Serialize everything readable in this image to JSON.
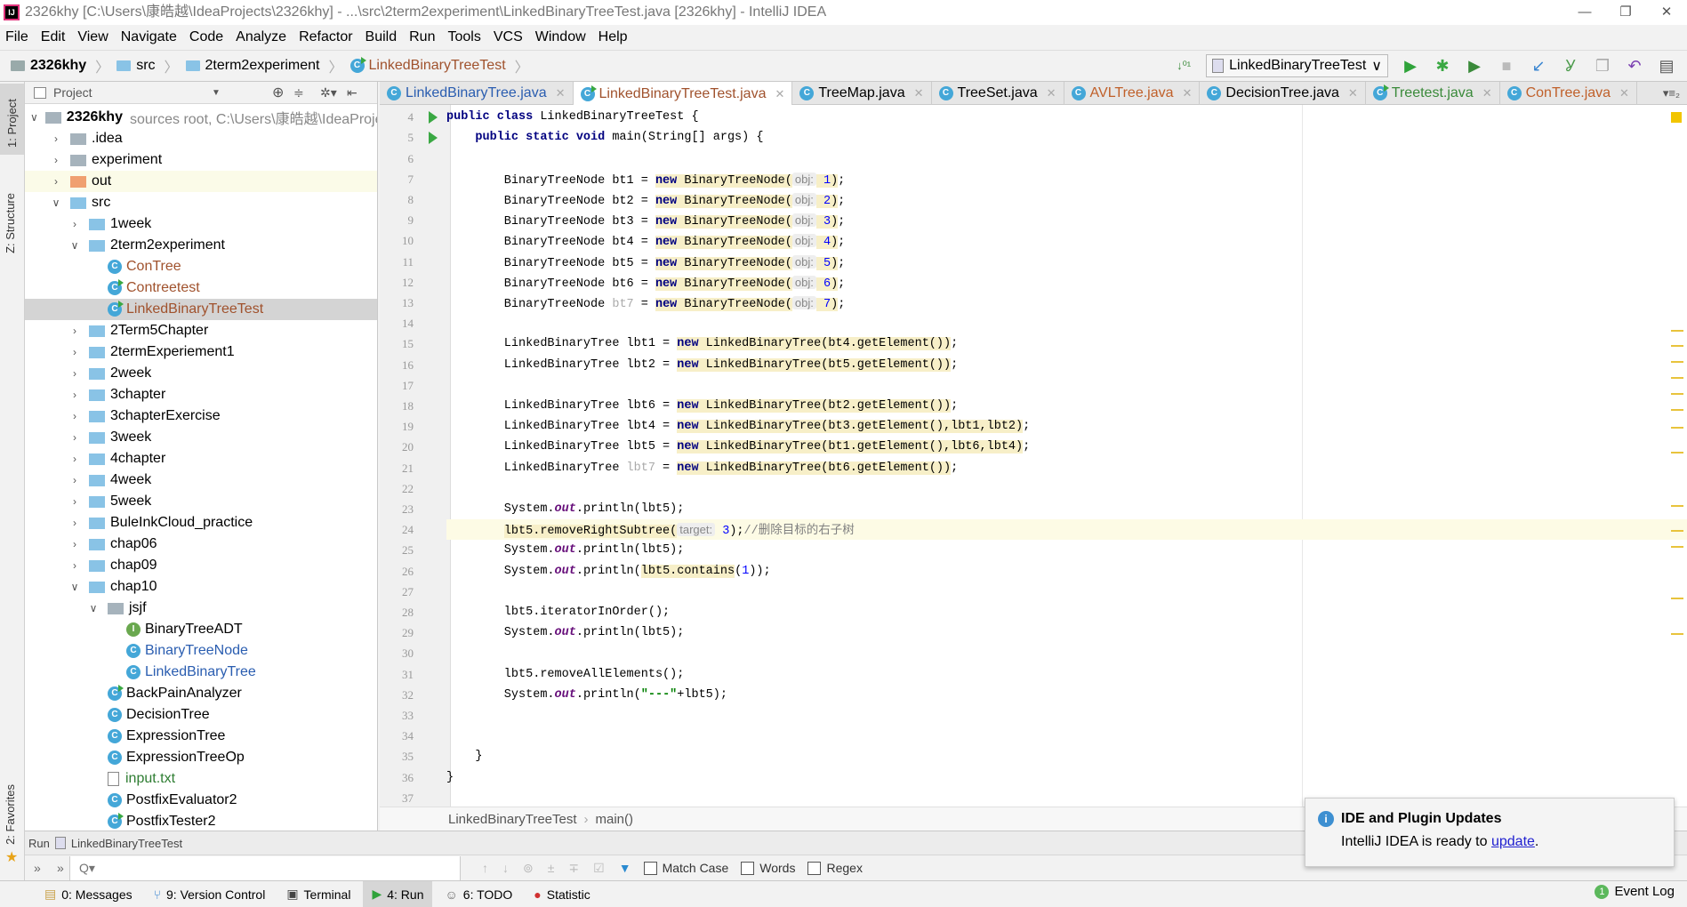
{
  "title_bar": {
    "text": "2326khy [C:\\Users\\康皓越\\IdeaProjects\\2326khy] - ...\\src\\2term2experiment\\LinkedBinaryTreeTest.java [2326khy] - IntelliJ IDEA",
    "minimize": "—",
    "maximize": "❐",
    "close": "✕"
  },
  "menu": [
    "File",
    "Edit",
    "View",
    "Navigate",
    "Code",
    "Analyze",
    "Refactor",
    "Build",
    "Run",
    "Tools",
    "VCS",
    "Window",
    "Help"
  ],
  "nav": {
    "project": "2326khy",
    "src": "src",
    "package": "2term2experiment",
    "file": "LinkedBinaryTreeTest"
  },
  "toolbar": {
    "run_config": "LinkedBinaryTreeTest",
    "icons": [
      "sort-icon",
      "run-icon",
      "debug-icon",
      "coverage-icon",
      "stop-icon",
      "vcs-update-icon",
      "vcs-commit-icon",
      "vcs-compare-icon",
      "revert-icon",
      "structure-icon"
    ]
  },
  "left_stripe": {
    "project": "1: Project",
    "structure": "Z: Structure",
    "favorites": "2: Favorites"
  },
  "project_panel": {
    "title": "Project",
    "tree": [
      {
        "label": "2326khy",
        "suffix": "sources root,  C:\\Users\\康皓越\\IdeaProjects",
        "depth": 0,
        "kind": "module",
        "open": true
      },
      {
        "label": ".idea",
        "depth": 1,
        "kind": "folder-gray",
        "open": false
      },
      {
        "label": "experiment",
        "depth": 1,
        "kind": "folder-gray",
        "open": false
      },
      {
        "label": "out",
        "depth": 1,
        "kind": "folder-orange",
        "open": false,
        "hl": true
      },
      {
        "label": "src",
        "depth": 1,
        "kind": "folder",
        "open": true
      },
      {
        "label": "1week",
        "depth": 2,
        "kind": "folder",
        "open": false
      },
      {
        "label": "2term2experiment",
        "depth": 2,
        "kind": "folder",
        "open": true
      },
      {
        "label": "ConTree",
        "depth": 3,
        "kind": "class",
        "color": "#a0522d"
      },
      {
        "label": "Contreetest",
        "depth": 3,
        "kind": "class-run",
        "color": "#a0522d"
      },
      {
        "label": "LinkedBinaryTreeTest",
        "depth": 3,
        "kind": "class-run",
        "color": "#a0522d",
        "selected": true
      },
      {
        "label": "2Term5Chapter",
        "depth": 2,
        "kind": "folder",
        "open": false
      },
      {
        "label": "2termExperiement1",
        "depth": 2,
        "kind": "folder",
        "open": false
      },
      {
        "label": "2week",
        "depth": 2,
        "kind": "folder",
        "open": false
      },
      {
        "label": "3chapter",
        "depth": 2,
        "kind": "folder",
        "open": false
      },
      {
        "label": "3chapterExercise",
        "depth": 2,
        "kind": "folder",
        "open": false
      },
      {
        "label": "3week",
        "depth": 2,
        "kind": "folder",
        "open": false
      },
      {
        "label": "4chapter",
        "depth": 2,
        "kind": "folder",
        "open": false
      },
      {
        "label": "4week",
        "depth": 2,
        "kind": "folder",
        "open": false
      },
      {
        "label": "5week",
        "depth": 2,
        "kind": "folder",
        "open": false
      },
      {
        "label": "BuleInkCloud_practice",
        "depth": 2,
        "kind": "folder",
        "open": false
      },
      {
        "label": "chap06",
        "depth": 2,
        "kind": "folder",
        "open": false
      },
      {
        "label": "chap09",
        "depth": 2,
        "kind": "folder",
        "open": false
      },
      {
        "label": "chap10",
        "depth": 2,
        "kind": "folder",
        "open": true
      },
      {
        "label": "jsjf",
        "depth": 3,
        "kind": "folder-gray",
        "open": true
      },
      {
        "label": "BinaryTreeADT",
        "depth": 4,
        "kind": "interface"
      },
      {
        "label": "BinaryTreeNode",
        "depth": 4,
        "kind": "class",
        "color": "#2a5db0"
      },
      {
        "label": "LinkedBinaryTree",
        "depth": 4,
        "kind": "class",
        "color": "#2a5db0"
      },
      {
        "label": "BackPainAnalyzer",
        "depth": 3,
        "kind": "class-run"
      },
      {
        "label": "DecisionTree",
        "depth": 3,
        "kind": "class"
      },
      {
        "label": "ExpressionTree",
        "depth": 3,
        "kind": "class"
      },
      {
        "label": "ExpressionTreeOp",
        "depth": 3,
        "kind": "class"
      },
      {
        "label": "input.txt",
        "depth": 3,
        "kind": "text",
        "color": "#2e7d32"
      },
      {
        "label": "PostfixEvaluator2",
        "depth": 3,
        "kind": "class"
      },
      {
        "label": "PostfixTester2",
        "depth": 3,
        "kind": "class-run"
      }
    ]
  },
  "tabs": [
    {
      "label": "LinkedBinaryTree.java",
      "color": "#2a5db0",
      "kind": "class"
    },
    {
      "label": "LinkedBinaryTreeTest.java",
      "color": "#a0522d",
      "kind": "class-run",
      "active": true
    },
    {
      "label": "TreeMap.java",
      "color": "#000000",
      "kind": "class"
    },
    {
      "label": "TreeSet.java",
      "color": "#000000",
      "kind": "class"
    },
    {
      "label": "AVLTree.java",
      "color": "#c0602a",
      "kind": "class"
    },
    {
      "label": "DecisionTree.java",
      "color": "#000000",
      "kind": "class"
    },
    {
      "label": "Treetest.java",
      "color": "#3a8a3a",
      "kind": "class-run"
    },
    {
      "label": "ConTree.java",
      "color": "#c0602a",
      "kind": "class"
    }
  ],
  "tabs_overflow": "▾≡₂",
  "editor": {
    "first_line": 3,
    "current_line": 24,
    "run_lines": [
      4,
      5
    ],
    "lines": [
      [
        [
          "",
          ""
        ]
      ],
      [
        [
          "public class",
          "kw"
        ],
        [
          " LinkedBinaryTreeTest {",
          ""
        ]
      ],
      [
        [
          "    ",
          ""
        ],
        [
          "public static void",
          "kw"
        ],
        [
          " main(String[] args) {",
          ""
        ]
      ],
      [
        [
          "",
          ""
        ]
      ],
      [
        [
          "        BinaryTreeNode bt1 = ",
          ""
        ],
        [
          "new",
          "kw warn"
        ],
        [
          " BinaryTreeNode(",
          "warn"
        ],
        [
          "obj:",
          "hint"
        ],
        [
          " 1",
          "num warn"
        ],
        [
          ")",
          "warn"
        ],
        [
          ";",
          ""
        ]
      ],
      [
        [
          "        BinaryTreeNode bt2 = ",
          ""
        ],
        [
          "new",
          "kw warn"
        ],
        [
          " BinaryTreeNode(",
          "warn"
        ],
        [
          "obj:",
          "hint"
        ],
        [
          " 2",
          "num warn"
        ],
        [
          ")",
          "warn"
        ],
        [
          ";",
          ""
        ]
      ],
      [
        [
          "        BinaryTreeNode bt3 = ",
          ""
        ],
        [
          "new",
          "kw warn"
        ],
        [
          " BinaryTreeNode(",
          "warn"
        ],
        [
          "obj:",
          "hint"
        ],
        [
          " 3",
          "num warn"
        ],
        [
          ")",
          "warn"
        ],
        [
          ";",
          ""
        ]
      ],
      [
        [
          "        BinaryTreeNode bt4 = ",
          ""
        ],
        [
          "new",
          "kw warn"
        ],
        [
          " BinaryTreeNode(",
          "warn"
        ],
        [
          "obj:",
          "hint"
        ],
        [
          " 4",
          "num warn"
        ],
        [
          ")",
          "warn"
        ],
        [
          ";",
          ""
        ]
      ],
      [
        [
          "        BinaryTreeNode bt5 = ",
          ""
        ],
        [
          "new",
          "kw warn"
        ],
        [
          " BinaryTreeNode(",
          "warn"
        ],
        [
          "obj:",
          "hint"
        ],
        [
          " 5",
          "num warn"
        ],
        [
          ")",
          "warn"
        ],
        [
          ";",
          ""
        ]
      ],
      [
        [
          "        BinaryTreeNode bt6 = ",
          ""
        ],
        [
          "new",
          "kw warn"
        ],
        [
          " BinaryTreeNode(",
          "warn"
        ],
        [
          "obj:",
          "hint"
        ],
        [
          " 6",
          "num warn"
        ],
        [
          ")",
          "warn"
        ],
        [
          ";",
          ""
        ]
      ],
      [
        [
          "        BinaryTreeNode ",
          ""
        ],
        [
          "bt7",
          "unused"
        ],
        [
          " = ",
          ""
        ],
        [
          "new",
          "kw warn"
        ],
        [
          " BinaryTreeNode(",
          "warn"
        ],
        [
          "obj:",
          "hint"
        ],
        [
          " 7",
          "num warn"
        ],
        [
          ")",
          "warn"
        ],
        [
          ";",
          ""
        ]
      ],
      [
        [
          "",
          ""
        ]
      ],
      [
        [
          "        LinkedBinaryTree lbt1 = ",
          ""
        ],
        [
          "new",
          "kw warn"
        ],
        [
          " LinkedBinaryTree(bt4.getElement())",
          "warn"
        ],
        [
          ";",
          ""
        ]
      ],
      [
        [
          "        LinkedBinaryTree lbt2 = ",
          ""
        ],
        [
          "new",
          "kw warn"
        ],
        [
          " LinkedBinaryTree(bt5.getElement())",
          "warn"
        ],
        [
          ";",
          ""
        ]
      ],
      [
        [
          "",
          ""
        ]
      ],
      [
        [
          "        LinkedBinaryTree lbt6 = ",
          ""
        ],
        [
          "new",
          "kw warn"
        ],
        [
          " LinkedBinaryTree(bt2.getElement())",
          "warn"
        ],
        [
          ";",
          ""
        ]
      ],
      [
        [
          "        LinkedBinaryTree lbt4 = ",
          ""
        ],
        [
          "new",
          "kw warn"
        ],
        [
          " LinkedBinaryTree(bt3.getElement(),lbt1,lbt2)",
          "warn"
        ],
        [
          ";",
          ""
        ]
      ],
      [
        [
          "        LinkedBinaryTree lbt5 = ",
          ""
        ],
        [
          "new",
          "kw warn"
        ],
        [
          " LinkedBinaryTree(bt1.getElement(),lbt6,lbt4)",
          "warn"
        ],
        [
          ";",
          ""
        ]
      ],
      [
        [
          "        LinkedBinaryTree ",
          ""
        ],
        [
          "lbt7",
          "unused"
        ],
        [
          " = ",
          ""
        ],
        [
          "new",
          "kw warn"
        ],
        [
          " LinkedBinaryTree(bt6.getElement())",
          "warn"
        ],
        [
          ";",
          ""
        ]
      ],
      [
        [
          "",
          ""
        ]
      ],
      [
        [
          "        System.",
          ""
        ],
        [
          "out",
          "st"
        ],
        [
          ".println(lbt5);",
          ""
        ]
      ],
      [
        [
          "        ",
          ""
        ],
        [
          "lbt5.removeRightSubtree(",
          "warn"
        ],
        [
          "target:",
          "hint"
        ],
        [
          " 3",
          "num"
        ],
        [
          ");",
          ""
        ],
        [
          "//删除目标的右子树",
          "cm"
        ]
      ],
      [
        [
          "        System.",
          ""
        ],
        [
          "out",
          "st"
        ],
        [
          ".println(lbt5);",
          ""
        ]
      ],
      [
        [
          "        System.",
          ""
        ],
        [
          "out",
          "st"
        ],
        [
          ".println(",
          ""
        ],
        [
          "lbt5.contains",
          "warn"
        ],
        [
          "(",
          ""
        ],
        [
          "1",
          "num"
        ],
        [
          "));",
          ""
        ]
      ],
      [
        [
          "",
          ""
        ]
      ],
      [
        [
          "        lbt5.iteratorInOrder();",
          ""
        ]
      ],
      [
        [
          "        System.",
          ""
        ],
        [
          "out",
          "st"
        ],
        [
          ".println(lbt5);",
          ""
        ]
      ],
      [
        [
          "",
          ""
        ]
      ],
      [
        [
          "        lbt5.removeAllElements();",
          ""
        ]
      ],
      [
        [
          "        System.",
          ""
        ],
        [
          "out",
          "st"
        ],
        [
          ".println(",
          ""
        ],
        [
          "\"---\"",
          "str"
        ],
        [
          "+lbt5);",
          ""
        ]
      ],
      [
        [
          "",
          ""
        ]
      ],
      [
        [
          "",
          ""
        ]
      ],
      [
        [
          "    }",
          ""
        ]
      ],
      [
        [
          "}",
          ""
        ]
      ],
      [
        [
          "",
          ""
        ]
      ]
    ]
  },
  "editor_breadcrumb": [
    "LinkedBinaryTreeTest",
    "main()"
  ],
  "run_panel": {
    "label": "Run",
    "config": "LinkedBinaryTreeTest",
    "search_placeholder": "Q▾",
    "match_case": "Match Case",
    "words": "Words",
    "regex": "Regex"
  },
  "bottom_tools": [
    {
      "label": "0: Messages",
      "icon": "messages-icon"
    },
    {
      "label": "9: Version Control",
      "icon": "version-control-icon"
    },
    {
      "label": "Terminal",
      "icon": "terminal-icon"
    },
    {
      "label": "4: Run",
      "icon": "run-icon",
      "active": true
    },
    {
      "label": "6: TODO",
      "icon": "todo-icon"
    },
    {
      "label": "Statistic",
      "icon": "statistic-icon"
    }
  ],
  "event_log": {
    "count": "1",
    "label": "Event Log"
  },
  "notification": {
    "title": "IDE and Plugin Updates",
    "text": "IntelliJ IDEA is ready to ",
    "link": "update",
    "end": "."
  }
}
